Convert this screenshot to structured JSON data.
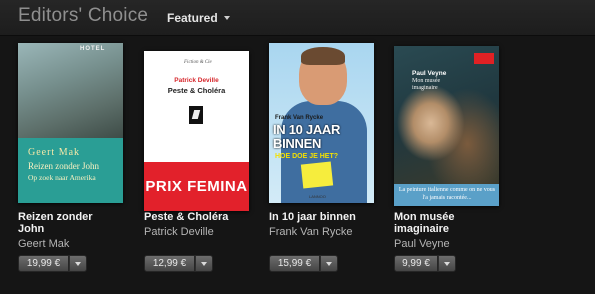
{
  "header": {
    "title": "Editors' Choice",
    "dropdown_label": "Featured"
  },
  "items": [
    {
      "title": "Reizen zonder John",
      "author": "Geert Mak",
      "price": "19,99 €",
      "cover": {
        "sign": "HOTEL",
        "author": "Geert Mak",
        "title": "Reizen zonder John",
        "subtitle": "Op zoek naar Amerika"
      }
    },
    {
      "title": "Peste & Choléra",
      "author": "Patrick Deville",
      "price": "12,99 €",
      "cover": {
        "collection": "Fiction & Cie",
        "author": "Patrick Deville",
        "title": "Peste & Choléra",
        "band": "PRIX FEMINA",
        "publisher": "Seuil"
      }
    },
    {
      "title": "In 10 jaar binnen",
      "author": "Frank Van Rycke",
      "price": "15,99 €",
      "cover": {
        "author": "Frank Van Rycke",
        "title": "IN 10 JAAR BINNEN",
        "tagline": "HOE DOE JE HET?",
        "publisher": "LANNOO"
      }
    },
    {
      "title": "Mon musée imaginaire",
      "author": "Paul Veyne",
      "price": "9,99 €",
      "cover": {
        "author": "Paul Veyne",
        "title": "Mon musée imaginaire",
        "band": "La peinture italienne comme on ne vous l'a jamais racontée..."
      }
    }
  ]
}
